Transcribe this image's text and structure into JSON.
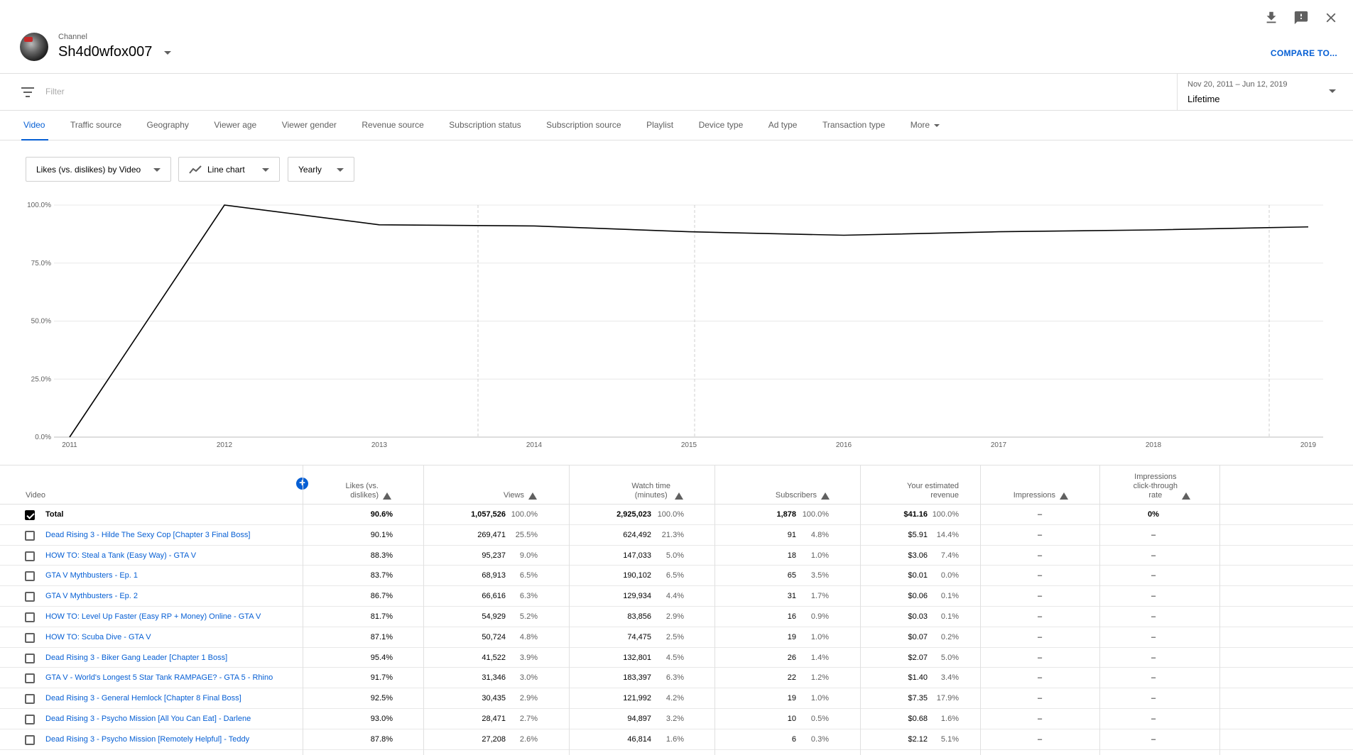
{
  "header": {
    "channel_label": "Channel",
    "channel_name": "Sh4d0wfox007",
    "compare_label": "COMPARE TO...",
    "icons": [
      "download-icon",
      "feedback-icon",
      "close-icon"
    ]
  },
  "filter": {
    "placeholder": "Filter"
  },
  "date": {
    "range": "Nov 20, 2011 – Jun 12, 2019",
    "value": "Lifetime"
  },
  "tabs": [
    "Video",
    "Traffic source",
    "Geography",
    "Viewer age",
    "Viewer gender",
    "Revenue source",
    "Subscription status",
    "Subscription source",
    "Playlist",
    "Device type",
    "Ad type",
    "Transaction type",
    "More"
  ],
  "controls": {
    "metric": "Likes (vs. dislikes) by Video",
    "chart_type": "Line chart",
    "period": "Yearly"
  },
  "chart_data": {
    "type": "line",
    "x": [
      "2011",
      "2012",
      "2013",
      "2014",
      "2015",
      "2016",
      "2017",
      "2018",
      "2019"
    ],
    "values": [
      0,
      100,
      91.5,
      91,
      88.5,
      87,
      88.5,
      89.3,
      90.6
    ],
    "ylim": [
      0,
      100
    ],
    "yticks": [
      "0.0%",
      "25.0%",
      "50.0%",
      "75.0%",
      "100.0%"
    ],
    "grid": true
  },
  "table": {
    "headers": {
      "video": "Video",
      "likes": [
        "Likes (vs.",
        "dislikes)"
      ],
      "views": [
        "Views"
      ],
      "watch": [
        "Watch time",
        "(minutes)"
      ],
      "subs": [
        "Subscribers"
      ],
      "revenue": [
        "Your estimated",
        "revenue"
      ],
      "impressions": [
        "Impressions"
      ],
      "ctr": [
        "Impressions",
        "click-through",
        "rate"
      ]
    },
    "rows": [
      {
        "title": "Total",
        "total": true,
        "checked": true,
        "likes": "90.6%",
        "views": "1,057,526",
        "views_pct": "100.0%",
        "watch": "2,925,023",
        "watch_pct": "100.0%",
        "subs": "1,878",
        "subs_pct": "100.0%",
        "rev": "$41.16",
        "rev_pct": "100.0%",
        "impr": "–",
        "ctr": "0%"
      },
      {
        "title": "Dead Rising 3 - Hilde The Sexy Cop [Chapter 3 Final Boss]",
        "likes": "90.1%",
        "views": "269,471",
        "views_pct": "25.5%",
        "watch": "624,492",
        "watch_pct": "21.3%",
        "subs": "91",
        "subs_pct": "4.8%",
        "rev": "$5.91",
        "rev_pct": "14.4%",
        "impr": "–",
        "ctr": "–"
      },
      {
        "title": "HOW TO: Steal a Tank (Easy Way) - GTA V",
        "likes": "88.3%",
        "views": "95,237",
        "views_pct": "9.0%",
        "watch": "147,033",
        "watch_pct": "5.0%",
        "subs": "18",
        "subs_pct": "1.0%",
        "rev": "$3.06",
        "rev_pct": "7.4%",
        "impr": "–",
        "ctr": "–"
      },
      {
        "title": "GTA V Mythbusters - Ep. 1",
        "likes": "83.7%",
        "views": "68,913",
        "views_pct": "6.5%",
        "watch": "190,102",
        "watch_pct": "6.5%",
        "subs": "65",
        "subs_pct": "3.5%",
        "rev": "$0.01",
        "rev_pct": "0.0%",
        "impr": "–",
        "ctr": "–"
      },
      {
        "title": "GTA V Mythbusters - Ep. 2",
        "likes": "86.7%",
        "views": "66,616",
        "views_pct": "6.3%",
        "watch": "129,934",
        "watch_pct": "4.4%",
        "subs": "31",
        "subs_pct": "1.7%",
        "rev": "$0.06",
        "rev_pct": "0.1%",
        "impr": "–",
        "ctr": "–"
      },
      {
        "title": "HOW TO: Level Up Faster (Easy RP + Money) Online - GTA V",
        "likes": "81.7%",
        "views": "54,929",
        "views_pct": "5.2%",
        "watch": "83,856",
        "watch_pct": "2.9%",
        "subs": "16",
        "subs_pct": "0.9%",
        "rev": "$0.03",
        "rev_pct": "0.1%",
        "impr": "–",
        "ctr": "–"
      },
      {
        "title": "HOW TO: Scuba Dive - GTA V",
        "likes": "87.1%",
        "views": "50,724",
        "views_pct": "4.8%",
        "watch": "74,475",
        "watch_pct": "2.5%",
        "subs": "19",
        "subs_pct": "1.0%",
        "rev": "$0.07",
        "rev_pct": "0.2%",
        "impr": "–",
        "ctr": "–"
      },
      {
        "title": "Dead Rising 3 - Biker Gang Leader [Chapter 1 Boss]",
        "likes": "95.4%",
        "views": "41,522",
        "views_pct": "3.9%",
        "watch": "132,801",
        "watch_pct": "4.5%",
        "subs": "26",
        "subs_pct": "1.4%",
        "rev": "$2.07",
        "rev_pct": "5.0%",
        "impr": "–",
        "ctr": "–"
      },
      {
        "title": "GTA V - World's Longest 5 Star Tank RAMPAGE? - GTA 5 - Rhino",
        "likes": "91.7%",
        "views": "31,346",
        "views_pct": "3.0%",
        "watch": "183,397",
        "watch_pct": "6.3%",
        "subs": "22",
        "subs_pct": "1.2%",
        "rev": "$1.40",
        "rev_pct": "3.4%",
        "impr": "–",
        "ctr": "–"
      },
      {
        "title": "Dead Rising 3 - General Hemlock [Chapter 8 Final Boss]",
        "likes": "92.5%",
        "views": "30,435",
        "views_pct": "2.9%",
        "watch": "121,992",
        "watch_pct": "4.2%",
        "subs": "19",
        "subs_pct": "1.0%",
        "rev": "$7.35",
        "rev_pct": "17.9%",
        "impr": "–",
        "ctr": "–"
      },
      {
        "title": "Dead Rising 3 - Psycho Mission [All You Can Eat] - Darlene",
        "likes": "93.0%",
        "views": "28,471",
        "views_pct": "2.7%",
        "watch": "94,897",
        "watch_pct": "3.2%",
        "subs": "10",
        "subs_pct": "0.5%",
        "rev": "$0.68",
        "rev_pct": "1.6%",
        "impr": "–",
        "ctr": "–"
      },
      {
        "title": "Dead Rising 3 - Psycho Mission [Remotely Helpful] - Teddy",
        "likes": "87.8%",
        "views": "27,208",
        "views_pct": "2.6%",
        "watch": "46,814",
        "watch_pct": "1.6%",
        "subs": "6",
        "subs_pct": "0.3%",
        "rev": "$2.12",
        "rev_pct": "5.1%",
        "impr": "–",
        "ctr": "–"
      }
    ]
  }
}
